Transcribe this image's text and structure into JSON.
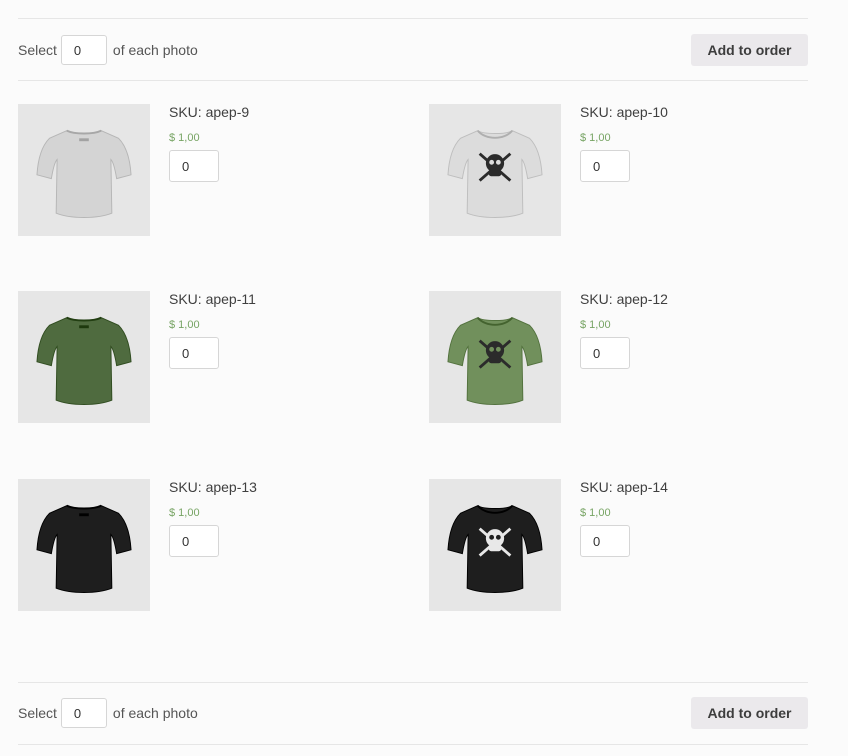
{
  "select_bar_top": {
    "label_before": "Select",
    "value": "0",
    "label_after": "of each photo",
    "button_label": "Add to order"
  },
  "select_bar_bottom": {
    "label_before": "Select",
    "value": "0",
    "label_after": "of each photo",
    "button_label": "Add to order"
  },
  "products": [
    {
      "sku": "SKU: apep-9",
      "price": "$ 1,00",
      "qty": "0",
      "color": "#d4d4d4",
      "view": "back"
    },
    {
      "sku": "SKU: apep-10",
      "price": "$ 1,00",
      "qty": "0",
      "color": "#dcdcdc",
      "view": "front"
    },
    {
      "sku": "SKU: apep-11",
      "price": "$ 1,00",
      "qty": "0",
      "color": "#4f6b3f",
      "view": "back"
    },
    {
      "sku": "SKU: apep-12",
      "price": "$ 1,00",
      "qty": "0",
      "color": "#71905c",
      "view": "front"
    },
    {
      "sku": "SKU: apep-13",
      "price": "$ 1,00",
      "qty": "0",
      "color": "#1e1e1e",
      "view": "back"
    },
    {
      "sku": "SKU: apep-14",
      "price": "$ 1,00",
      "qty": "0",
      "color": "#1e1e1e",
      "view": "front"
    }
  ],
  "colors": {
    "price": "#77a464",
    "button_bg": "#ebe9ec",
    "divider": "#e6e6e6"
  }
}
